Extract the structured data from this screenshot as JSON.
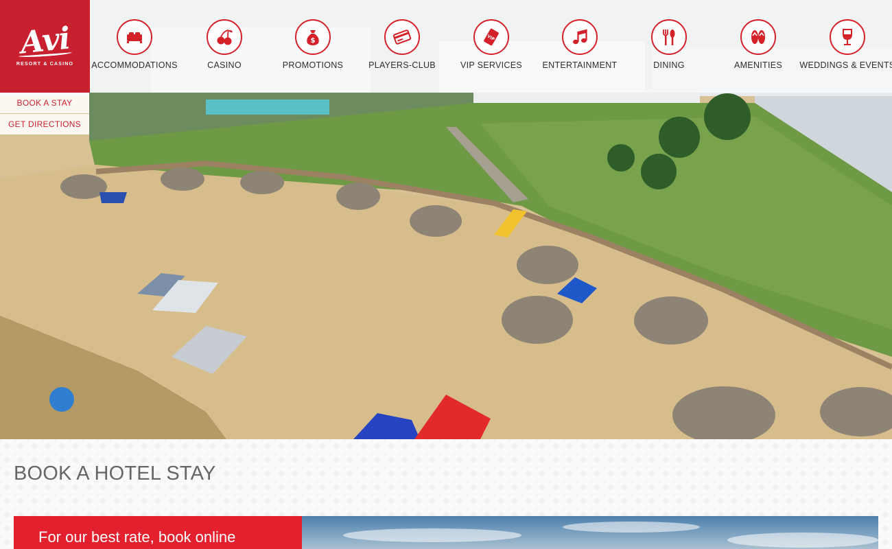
{
  "brand": {
    "logo_text": "Avi",
    "logo_subtext": "RESORT & CASINO",
    "accent_color": "#c8202f"
  },
  "nav": {
    "items": [
      {
        "label": "ACCOMMODATIONS",
        "icon": "bed-icon"
      },
      {
        "label": "CASINO",
        "icon": "cherries-icon"
      },
      {
        "label": "PROMOTIONS",
        "icon": "money-bag-icon"
      },
      {
        "label": "PLAYERS-CLUB",
        "icon": "card-icon"
      },
      {
        "label": "VIP SERVICES",
        "icon": "vip-ticket-icon"
      },
      {
        "label": "ENTERTAINMENT",
        "icon": "music-note-icon"
      },
      {
        "label": "DINING",
        "icon": "utensils-icon"
      },
      {
        "label": "AMENITIES",
        "icon": "flip-flops-icon"
      },
      {
        "label": "WEDDINGS & EVENTS",
        "icon": "wine-glass-icon"
      }
    ]
  },
  "side_links": {
    "book_stay": "BOOK A STAY",
    "get_directions": "GET DIRECTIONS"
  },
  "section": {
    "title": "BOOK A HOTEL STAY",
    "promo_text": "For our best rate, book online"
  }
}
